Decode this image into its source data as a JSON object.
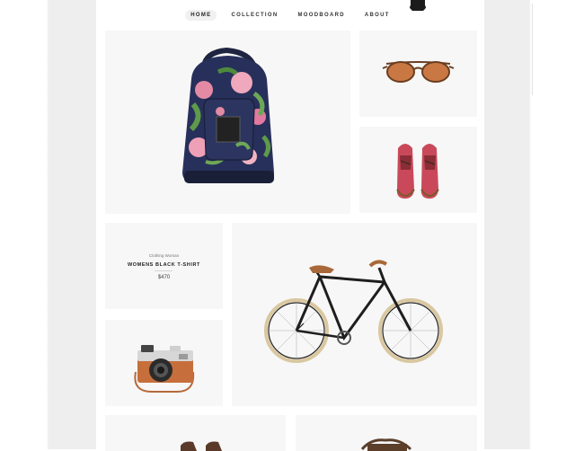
{
  "nav": {
    "items": [
      {
        "label": "HOME",
        "active": true
      },
      {
        "label": "COLLECTION",
        "active": false
      },
      {
        "label": "MOODBOARD",
        "active": false
      },
      {
        "label": "ABOUT",
        "active": false
      }
    ]
  },
  "products": {
    "featured": {
      "category": "Clothing Woman",
      "title": "WOMENS BLACK T-SHIRT",
      "price": "$470"
    },
    "images": [
      "backpack",
      "sunglasses",
      "shoes",
      "bicycle",
      "camera",
      "boots",
      "bag"
    ]
  },
  "colors": {
    "card_bg": "#f7f7f7",
    "side_bg": "#eeeeee",
    "nav_active_bg": "#f1f1f1"
  }
}
